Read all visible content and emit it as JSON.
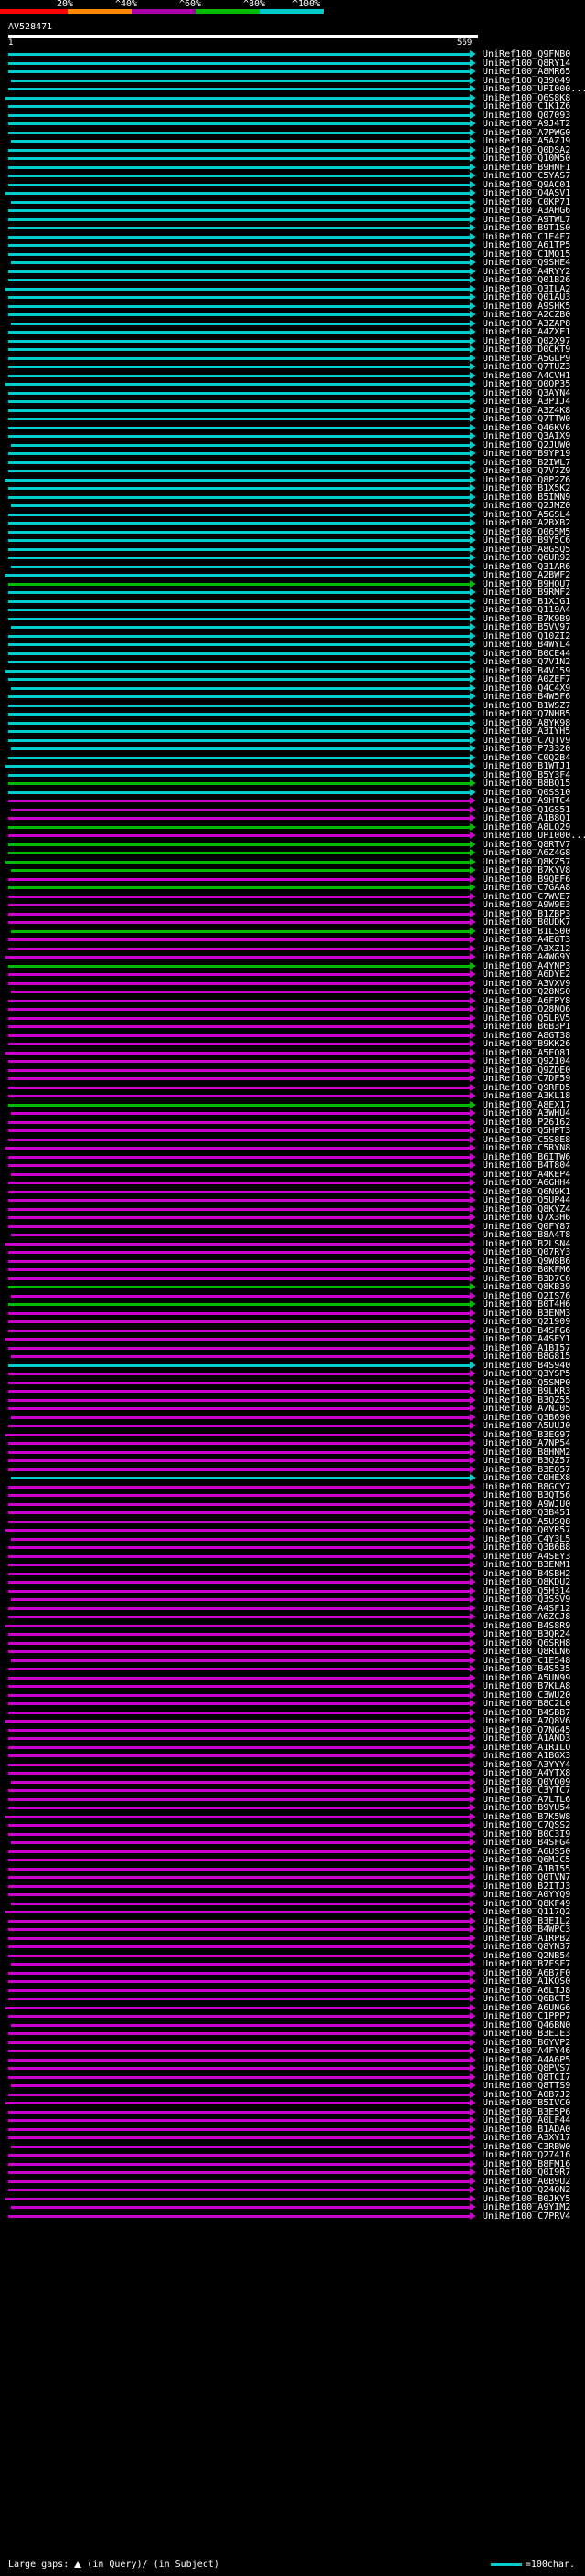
{
  "legend": {
    "labels": [
      "20%",
      "^40%",
      "^60%",
      "^80%",
      "^100%"
    ],
    "colors": [
      "#ff0000",
      "#ff8800",
      "#aa00aa",
      "#00bb00",
      "#00cccc"
    ]
  },
  "query": {
    "id": "AV528471",
    "start": "1",
    "end": "569"
  },
  "colors": {
    "cyan": "#00cccc",
    "green": "#00bb00",
    "magenta": "#cc00cc"
  },
  "hits": [
    {
      "label": "UniRef100_Q9FNB0",
      "color": "cyan"
    },
    {
      "label": "UniRef100_Q8RY14",
      "color": "cyan"
    },
    {
      "label": "UniRef100_A8MR65",
      "color": "cyan"
    },
    {
      "label": "UniRef100_Q39049",
      "color": "cyan"
    },
    {
      "label": "UniRef100_UPI000...",
      "color": "cyan"
    },
    {
      "label": "UniRef100_Q6S8K8",
      "color": "cyan"
    },
    {
      "label": "UniRef100_C1K1Z6",
      "color": "cyan"
    },
    {
      "label": "UniRef100_Q07093",
      "color": "cyan"
    },
    {
      "label": "UniRef100_A9J4T2",
      "color": "cyan"
    },
    {
      "label": "UniRef100_A7PWG0",
      "color": "cyan"
    },
    {
      "label": "UniRef100_A5AZJ9",
      "color": "cyan"
    },
    {
      "label": "UniRef100_Q0DSA2",
      "color": "cyan"
    },
    {
      "label": "UniRef100_Q10M50",
      "color": "cyan"
    },
    {
      "label": "UniRef100_B9HNF1",
      "color": "cyan"
    },
    {
      "label": "UniRef100_C5YAS7",
      "color": "cyan"
    },
    {
      "label": "UniRef100_Q9AC01",
      "color": "cyan"
    },
    {
      "label": "UniRef100_Q4ASV1",
      "color": "cyan"
    },
    {
      "label": "UniRef100_C0KP71",
      "color": "cyan"
    },
    {
      "label": "UniRef100_A3AHG6",
      "color": "cyan"
    },
    {
      "label": "UniRef100_A9TWL7",
      "color": "cyan"
    },
    {
      "label": "UniRef100_B9T1S0",
      "color": "cyan"
    },
    {
      "label": "UniRef100_C1E4F7",
      "color": "cyan"
    },
    {
      "label": "UniRef100_A61TP5",
      "color": "cyan"
    },
    {
      "label": "UniRef100_C1MQ15",
      "color": "cyan"
    },
    {
      "label": "UniRef100_Q9SHE4",
      "color": "cyan"
    },
    {
      "label": "UniRef100_A4RYY2",
      "color": "cyan"
    },
    {
      "label": "UniRef100_Q01B26",
      "color": "cyan"
    },
    {
      "label": "UniRef100_Q3ILA2",
      "color": "cyan"
    },
    {
      "label": "UniRef100_Q01AU3",
      "color": "cyan"
    },
    {
      "label": "UniRef100_A9SHK5",
      "color": "cyan"
    },
    {
      "label": "UniRef100_A2CZB0",
      "color": "cyan"
    },
    {
      "label": "UniRef100_A3ZAP8",
      "color": "cyan"
    },
    {
      "label": "UniRef100_A4ZXE1",
      "color": "cyan"
    },
    {
      "label": "UniRef100_Q02X97",
      "color": "cyan"
    },
    {
      "label": "UniRef100_D0CKT9",
      "color": "cyan"
    },
    {
      "label": "UniRef100_A5GLP9",
      "color": "cyan"
    },
    {
      "label": "UniRef100_Q7TUZ3",
      "color": "cyan"
    },
    {
      "label": "UniRef100_A4CVH1",
      "color": "cyan"
    },
    {
      "label": "UniRef100_Q0QP35",
      "color": "cyan"
    },
    {
      "label": "UniRef100_Q3AYN4",
      "color": "cyan"
    },
    {
      "label": "UniRef100_A3PIJ4",
      "color": "cyan"
    },
    {
      "label": "UniRef100_A3Z4K8",
      "color": "cyan"
    },
    {
      "label": "UniRef100_Q7TTW0",
      "color": "cyan"
    },
    {
      "label": "UniRef100_Q46KV6",
      "color": "cyan"
    },
    {
      "label": "UniRef100_Q3AIX9",
      "color": "cyan"
    },
    {
      "label": "UniRef100_Q2JUW0",
      "color": "cyan"
    },
    {
      "label": "UniRef100_B9YP19",
      "color": "cyan"
    },
    {
      "label": "UniRef100_B2IWL7",
      "color": "cyan"
    },
    {
      "label": "UniRef100_Q7V7Z9",
      "color": "cyan"
    },
    {
      "label": "UniRef100_Q8P2Z6",
      "color": "cyan"
    },
    {
      "label": "UniRef100_B1X5K2",
      "color": "cyan"
    },
    {
      "label": "UniRef100_B5IMN9",
      "color": "cyan"
    },
    {
      "label": "UniRef100_Q2JMZ0",
      "color": "cyan"
    },
    {
      "label": "UniRef100_A5GSL4",
      "color": "cyan"
    },
    {
      "label": "UniRef100_A2BXB2",
      "color": "cyan"
    },
    {
      "label": "UniRef100_Q065M5",
      "color": "cyan"
    },
    {
      "label": "UniRef100_B9Y5C6",
      "color": "cyan"
    },
    {
      "label": "UniRef100_A8G5Q5",
      "color": "cyan"
    },
    {
      "label": "UniRef100_Q6UR92",
      "color": "cyan"
    },
    {
      "label": "UniRef100_Q31AR6",
      "color": "cyan"
    },
    {
      "label": "UniRef100_A2BWF2",
      "color": "cyan"
    },
    {
      "label": "UniRef100_B9HOU7",
      "color": "green"
    },
    {
      "label": "UniRef100_B9RMF2",
      "color": "cyan"
    },
    {
      "label": "UniRef100_B1XJG1",
      "color": "cyan"
    },
    {
      "label": "UniRef100_Q119A4",
      "color": "cyan"
    },
    {
      "label": "UniRef100_B7K9B9",
      "color": "cyan"
    },
    {
      "label": "UniRef100_B5VV97",
      "color": "cyan"
    },
    {
      "label": "UniRef100_Q10ZI2",
      "color": "cyan"
    },
    {
      "label": "UniRef100_B4WYL4",
      "color": "cyan"
    },
    {
      "label": "UniRef100_B0CE44",
      "color": "cyan"
    },
    {
      "label": "UniRef100_Q7V1N2",
      "color": "cyan"
    },
    {
      "label": "UniRef100_B4VJ59",
      "color": "cyan"
    },
    {
      "label": "UniRef100_A0ZEF7",
      "color": "cyan"
    },
    {
      "label": "UniRef100_Q4C4X9",
      "color": "cyan"
    },
    {
      "label": "UniRef100_B4W5F6",
      "color": "cyan"
    },
    {
      "label": "UniRef100_B1WSZ7",
      "color": "cyan"
    },
    {
      "label": "UniRef100_Q7NHB5",
      "color": "cyan"
    },
    {
      "label": "UniRef100_A8YK98",
      "color": "cyan"
    },
    {
      "label": "UniRef100_A3IYH5",
      "color": "cyan"
    },
    {
      "label": "UniRef100_C7QTV9",
      "color": "cyan"
    },
    {
      "label": "UniRef100_P73320",
      "color": "cyan"
    },
    {
      "label": "UniRef100_C0Q2B4",
      "color": "cyan"
    },
    {
      "label": "UniRef100_B1WTJ1",
      "color": "cyan"
    },
    {
      "label": "UniRef100_B5Y3F4",
      "color": "cyan"
    },
    {
      "label": "UniRef100_B8BQ15",
      "color": "green"
    },
    {
      "label": "UniRef100_Q0SS10",
      "color": "cyan"
    },
    {
      "label": "UniRef100_A9HTC4",
      "color": "magenta"
    },
    {
      "label": "UniRef100_Q1GS51",
      "color": "magenta"
    },
    {
      "label": "UniRef100_A1B8Q1",
      "color": "magenta"
    },
    {
      "label": "UniRef100_A8LQ29",
      "color": "green"
    },
    {
      "label": "UniRef100_UPI000...",
      "color": "magenta"
    },
    {
      "label": "UniRef100_Q8RTV7",
      "color": "green"
    },
    {
      "label": "UniRef100_A6Z4G8",
      "color": "green"
    },
    {
      "label": "UniRef100_Q8KZ57",
      "color": "green"
    },
    {
      "label": "UniRef100_B7KYV8",
      "color": "green"
    },
    {
      "label": "UniRef100_B9QEF6",
      "color": "magenta"
    },
    {
      "label": "UniRef100_C7GAA8",
      "color": "green"
    },
    {
      "label": "UniRef100_C7WVE7",
      "color": "magenta"
    },
    {
      "label": "UniRef100_A9W9E3",
      "color": "magenta"
    },
    {
      "label": "UniRef100_B1ZBP3",
      "color": "magenta"
    },
    {
      "label": "UniRef100_B0UDK7",
      "color": "magenta"
    },
    {
      "label": "UniRef100_B1LS00",
      "color": "green"
    },
    {
      "label": "UniRef100_A4EGT3",
      "color": "magenta"
    },
    {
      "label": "UniRef100_A3XZ12",
      "color": "magenta"
    },
    {
      "label": "UniRef100_A4WG9Y",
      "color": "magenta"
    },
    {
      "label": "UniRef100_A4YNP3",
      "color": "green"
    },
    {
      "label": "UniRef100_A6DYE2",
      "color": "magenta"
    },
    {
      "label": "UniRef100_A3VXV9",
      "color": "magenta"
    },
    {
      "label": "UniRef100_Q28NS0",
      "color": "magenta"
    },
    {
      "label": "UniRef100_A6FPY8",
      "color": "magenta"
    },
    {
      "label": "UniRef100_Q28NQ6",
      "color": "magenta"
    },
    {
      "label": "UniRef100_Q5LRV5",
      "color": "magenta"
    },
    {
      "label": "UniRef100_B6B3P1",
      "color": "magenta"
    },
    {
      "label": "UniRef100_A8GT38",
      "color": "magenta"
    },
    {
      "label": "UniRef100_B9KK26",
      "color": "magenta"
    },
    {
      "label": "UniRef100_A5EQ81",
      "color": "magenta"
    },
    {
      "label": "UniRef100_Q92I04",
      "color": "magenta"
    },
    {
      "label": "UniRef100_Q9ZDE0",
      "color": "magenta"
    },
    {
      "label": "UniRef100_C7DF59",
      "color": "magenta"
    },
    {
      "label": "UniRef100_Q9RFD5",
      "color": "magenta"
    },
    {
      "label": "UniRef100_A3KL18",
      "color": "magenta"
    },
    {
      "label": "UniRef100_A8EX17",
      "color": "green"
    },
    {
      "label": "UniRef100_A3WHU4",
      "color": "magenta"
    },
    {
      "label": "UniRef100_P26162",
      "color": "magenta"
    },
    {
      "label": "UniRef100_Q5HPT3",
      "color": "magenta"
    },
    {
      "label": "UniRef100_C5S8E8",
      "color": "magenta"
    },
    {
      "label": "UniRef100_C5RYN8",
      "color": "magenta"
    },
    {
      "label": "UniRef100_B6ITW6",
      "color": "magenta"
    },
    {
      "label": "UniRef100_B4T804",
      "color": "magenta"
    },
    {
      "label": "UniRef100_A4KEP4",
      "color": "magenta"
    },
    {
      "label": "UniRef100_A6GHH4",
      "color": "magenta"
    },
    {
      "label": "UniRef100_Q6N9K1",
      "color": "magenta"
    },
    {
      "label": "UniRef100_Q5UP44",
      "color": "magenta"
    },
    {
      "label": "UniRef100_Q8KYZ4",
      "color": "magenta"
    },
    {
      "label": "UniRef100_Q7X3H6",
      "color": "magenta"
    },
    {
      "label": "UniRef100_Q0FY87",
      "color": "magenta"
    },
    {
      "label": "UniRef100_B8A4T8",
      "color": "magenta"
    },
    {
      "label": "UniRef100_B2LSN4",
      "color": "magenta"
    },
    {
      "label": "UniRef100_Q07RY3",
      "color": "magenta"
    },
    {
      "label": "UniRef100_Q9W8B6",
      "color": "magenta"
    },
    {
      "label": "UniRef100_B0KFM6",
      "color": "magenta"
    },
    {
      "label": "UniRef100_B3D7C6",
      "color": "magenta"
    },
    {
      "label": "UniRef100_Q8KB39",
      "color": "green"
    },
    {
      "label": "UniRef100_Q2IS76",
      "color": "magenta"
    },
    {
      "label": "UniRef100_B0T4H6",
      "color": "green"
    },
    {
      "label": "UniRef100_B3ENM3",
      "color": "magenta"
    },
    {
      "label": "UniRef100_Q21909",
      "color": "magenta"
    },
    {
      "label": "UniRef100_B4SFG6",
      "color": "magenta"
    },
    {
      "label": "UniRef100_A4SEY1",
      "color": "magenta"
    },
    {
      "label": "UniRef100_A1BI57",
      "color": "magenta"
    },
    {
      "label": "UniRef100_B8G815",
      "color": "magenta"
    },
    {
      "label": "UniRef100_B4S940",
      "color": "cyan"
    },
    {
      "label": "UniRef100_Q3YSP5",
      "color": "magenta"
    },
    {
      "label": "UniRef100_Q5SMP0",
      "color": "magenta"
    },
    {
      "label": "UniRef100_B9LKR3",
      "color": "magenta"
    },
    {
      "label": "UniRef100_B3QZ55",
      "color": "magenta"
    },
    {
      "label": "UniRef100_A7NJ05",
      "color": "magenta"
    },
    {
      "label": "UniRef100_Q3B690",
      "color": "magenta"
    },
    {
      "label": "UniRef100_A5UUJ0",
      "color": "magenta"
    },
    {
      "label": "UniRef100_B3EG97",
      "color": "magenta"
    },
    {
      "label": "UniRef100_A7NP54",
      "color": "magenta"
    },
    {
      "label": "UniRef100_B8HNM2",
      "color": "magenta"
    },
    {
      "label": "UniRef100_B3QZ57",
      "color": "magenta"
    },
    {
      "label": "UniRef100_B3EQ57",
      "color": "magenta"
    },
    {
      "label": "UniRef100_C0HEX8",
      "color": "cyan"
    },
    {
      "label": "UniRef100_B8GCY7",
      "color": "magenta"
    },
    {
      "label": "UniRef100_B3QT56",
      "color": "magenta"
    },
    {
      "label": "UniRef100_A9WJU0",
      "color": "magenta"
    },
    {
      "label": "UniRef100_Q3B451",
      "color": "magenta"
    },
    {
      "label": "UniRef100_A5USQ8",
      "color": "magenta"
    },
    {
      "label": "UniRef100_Q0YR57",
      "color": "magenta"
    },
    {
      "label": "UniRef100_C4Y3L5",
      "color": "magenta"
    },
    {
      "label": "UniRef100_Q3B6B8",
      "color": "magenta"
    },
    {
      "label": "UniRef100_A4SEY3",
      "color": "magenta"
    },
    {
      "label": "UniRef100_B3ENM1",
      "color": "magenta"
    },
    {
      "label": "UniRef100_B4SBH2",
      "color": "magenta"
    },
    {
      "label": "UniRef100_Q8KDU2",
      "color": "magenta"
    },
    {
      "label": "UniRef100_Q5H314",
      "color": "magenta"
    },
    {
      "label": "UniRef100_Q3SSV9",
      "color": "magenta"
    },
    {
      "label": "UniRef100_A4SF12",
      "color": "magenta"
    },
    {
      "label": "UniRef100_A6ZCJ8",
      "color": "magenta"
    },
    {
      "label": "UniRef100_B4S8R9",
      "color": "magenta"
    },
    {
      "label": "UniRef100_B3QR24",
      "color": "magenta"
    },
    {
      "label": "UniRef100_Q6SRH8",
      "color": "magenta"
    },
    {
      "label": "UniRef100_Q8RLN6",
      "color": "magenta"
    },
    {
      "label": "UniRef100_C1E548",
      "color": "magenta"
    },
    {
      "label": "UniRef100_B4S535",
      "color": "magenta"
    },
    {
      "label": "UniRef100_A5UN99",
      "color": "magenta"
    },
    {
      "label": "UniRef100_B7KLA8",
      "color": "magenta"
    },
    {
      "label": "UniRef100_C3WU20",
      "color": "magenta"
    },
    {
      "label": "UniRef100_B8C2L0",
      "color": "magenta"
    },
    {
      "label": "UniRef100_B4SBB7",
      "color": "magenta"
    },
    {
      "label": "UniRef100_A7Q8V6",
      "color": "magenta"
    },
    {
      "label": "UniRef100_Q7NG45",
      "color": "magenta"
    },
    {
      "label": "UniRef100_A1AND3",
      "color": "magenta"
    },
    {
      "label": "UniRef100_A1RILO",
      "color": "magenta"
    },
    {
      "label": "UniRef100_A1BGX3",
      "color": "magenta"
    },
    {
      "label": "UniRef100_A3YYY4",
      "color": "magenta"
    },
    {
      "label": "UniRef100_A4YTX8",
      "color": "magenta"
    },
    {
      "label": "UniRef100_Q0YQ09",
      "color": "magenta"
    },
    {
      "label": "UniRef100_C3YTC7",
      "color": "magenta"
    },
    {
      "label": "UniRef100_A7LTL6",
      "color": "magenta"
    },
    {
      "label": "UniRef100_B9YU54",
      "color": "magenta"
    },
    {
      "label": "UniRef100_B7K5W8",
      "color": "magenta"
    },
    {
      "label": "UniRef100_C7QSS2",
      "color": "magenta"
    },
    {
      "label": "UniRef100_B0C3I9",
      "color": "magenta"
    },
    {
      "label": "UniRef100_B4SFG4",
      "color": "magenta"
    },
    {
      "label": "UniRef100_A6US50",
      "color": "magenta"
    },
    {
      "label": "UniRef100_Q6MJC5",
      "color": "magenta"
    },
    {
      "label": "UniRef100_A1BI55",
      "color": "magenta"
    },
    {
      "label": "UniRef100_Q0TVN7",
      "color": "magenta"
    },
    {
      "label": "UniRef100_B2ITJ3",
      "color": "magenta"
    },
    {
      "label": "UniRef100_A0YYQ9",
      "color": "magenta"
    },
    {
      "label": "UniRef100_Q8KF49",
      "color": "magenta"
    },
    {
      "label": "UniRef100_Q117Q2",
      "color": "magenta"
    },
    {
      "label": "UniRef100_B3EIL2",
      "color": "magenta"
    },
    {
      "label": "UniRef100_B4WPC3",
      "color": "magenta"
    },
    {
      "label": "UniRef100_A1RPB2",
      "color": "magenta"
    },
    {
      "label": "UniRef100_Q8YN37",
      "color": "magenta"
    },
    {
      "label": "UniRef100_Q2NB54",
      "color": "magenta"
    },
    {
      "label": "UniRef100_B7FSF7",
      "color": "magenta"
    },
    {
      "label": "UniRef100_A6B7F0",
      "color": "magenta"
    },
    {
      "label": "UniRef100_A1KQS0",
      "color": "magenta"
    },
    {
      "label": "UniRef100_A6LTJ8",
      "color": "magenta"
    },
    {
      "label": "UniRef100_Q6BCT5",
      "color": "magenta"
    },
    {
      "label": "UniRef100_A6UNG6",
      "color": "magenta"
    },
    {
      "label": "UniRef100_C1PPP7",
      "color": "magenta"
    },
    {
      "label": "UniRef100_Q46BN0",
      "color": "magenta"
    },
    {
      "label": "UniRef100_B3EJE3",
      "color": "magenta"
    },
    {
      "label": "UniRef100_B6YVP2",
      "color": "magenta"
    },
    {
      "label": "UniRef100_A4FY46",
      "color": "magenta"
    },
    {
      "label": "UniRef100_A4A6P5",
      "color": "magenta"
    },
    {
      "label": "UniRef100_Q8PVS7",
      "color": "magenta"
    },
    {
      "label": "UniRef100_Q8TCI7",
      "color": "magenta"
    },
    {
      "label": "UniRef100_Q8TTS9",
      "color": "magenta"
    },
    {
      "label": "UniRef100_A0B7J2",
      "color": "magenta"
    },
    {
      "label": "UniRef100_B5IVC0",
      "color": "magenta"
    },
    {
      "label": "UniRef100_B3E5P6",
      "color": "magenta"
    },
    {
      "label": "UniRef100_A0LF44",
      "color": "magenta"
    },
    {
      "label": "UniRef100_B1ADA0",
      "color": "magenta"
    },
    {
      "label": "UniRef100_A3XY17",
      "color": "magenta"
    },
    {
      "label": "UniRef100_C3RBW0",
      "color": "magenta"
    },
    {
      "label": "UniRef100_Q27416",
      "color": "magenta"
    },
    {
      "label": "UniRef100_B8FM16",
      "color": "magenta"
    },
    {
      "label": "UniRef100_Q0I9R7",
      "color": "magenta"
    },
    {
      "label": "UniRef100_A0B9U2",
      "color": "magenta"
    },
    {
      "label": "UniRef100_Q24QN2",
      "color": "magenta"
    },
    {
      "label": "UniRef100_B0JKY5",
      "color": "magenta"
    },
    {
      "label": "UniRef100_A9YIM2",
      "color": "magenta"
    },
    {
      "label": "UniRef100_C7PRV4",
      "color": "magenta"
    }
  ],
  "footer": {
    "large_gaps": "Large gaps:",
    "in_query": "(in Query)/",
    "in_subject": "(in Subject)",
    "scale": "=100char."
  }
}
